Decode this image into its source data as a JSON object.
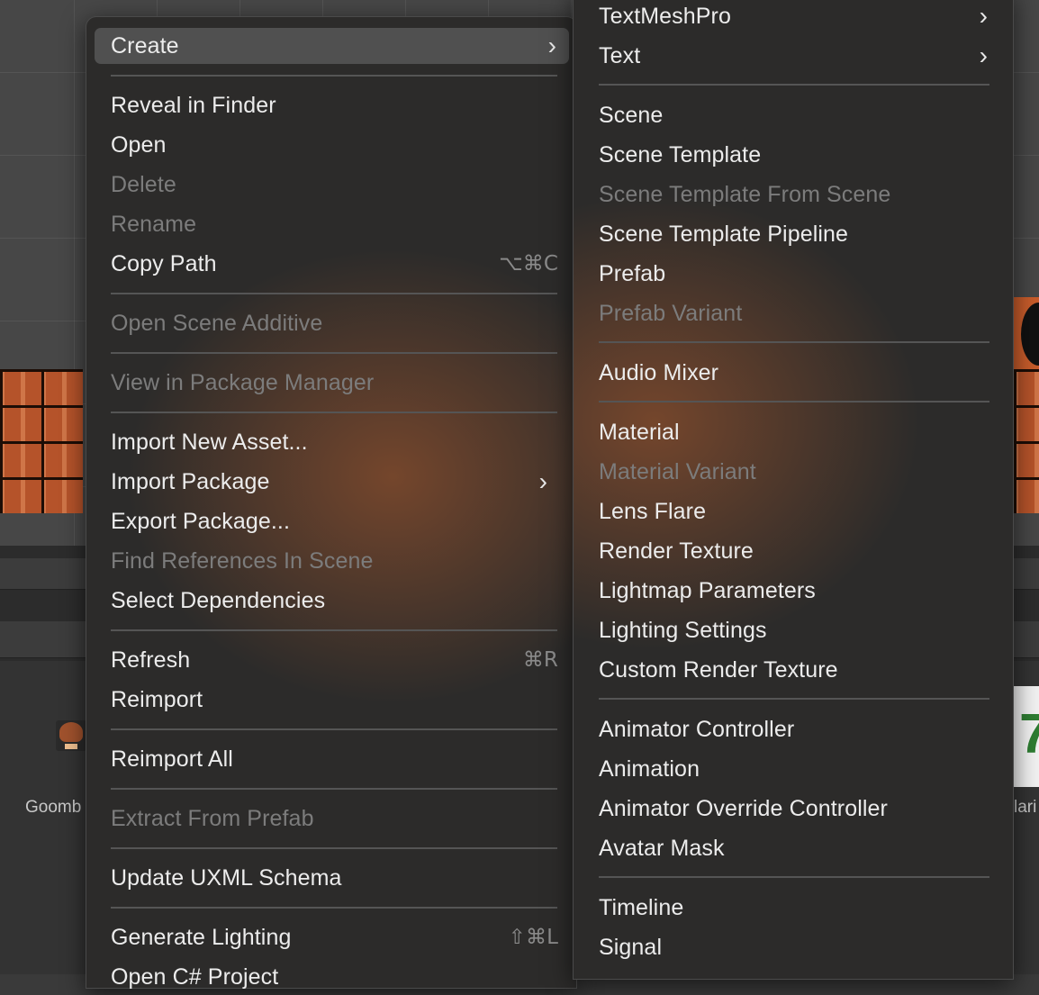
{
  "background": {
    "asset_labels": {
      "left": "Goomb",
      "right": "lari"
    },
    "asset_icon_right": "7"
  },
  "context_menu": {
    "items": [
      {
        "label": "Create",
        "submenu": true,
        "highlighted": true
      },
      {
        "label": "Reveal in Finder"
      },
      {
        "label": "Open"
      },
      {
        "label": "Delete",
        "disabled": true
      },
      {
        "label": "Rename",
        "disabled": true
      },
      {
        "label": "Copy Path",
        "shortcut": "⌥⌘C"
      },
      {
        "label": "Open Scene Additive",
        "disabled": true
      },
      {
        "label": "View in Package Manager",
        "disabled": true
      },
      {
        "label": "Import New Asset..."
      },
      {
        "label": "Import Package",
        "submenu": true
      },
      {
        "label": "Export Package..."
      },
      {
        "label": "Find References In Scene",
        "disabled": true
      },
      {
        "label": "Select Dependencies"
      },
      {
        "label": "Refresh",
        "shortcut": "⌘R"
      },
      {
        "label": "Reimport"
      },
      {
        "label": "Reimport All"
      },
      {
        "label": "Extract From Prefab",
        "disabled": true
      },
      {
        "label": "Update UXML Schema"
      },
      {
        "label": "Generate Lighting",
        "shortcut": "⇧⌘L"
      },
      {
        "label": "Open C# Project"
      }
    ]
  },
  "create_submenu": {
    "items": [
      {
        "label": "TextMeshPro",
        "submenu": true
      },
      {
        "label": "Text",
        "submenu": true
      },
      {
        "label": "Scene"
      },
      {
        "label": "Scene Template"
      },
      {
        "label": "Scene Template From Scene",
        "disabled": true
      },
      {
        "label": "Scene Template Pipeline"
      },
      {
        "label": "Prefab"
      },
      {
        "label": "Prefab Variant",
        "disabled": true
      },
      {
        "label": "Audio Mixer"
      },
      {
        "label": "Material"
      },
      {
        "label": "Material Variant",
        "disabled": true
      },
      {
        "label": "Lens Flare"
      },
      {
        "label": "Render Texture"
      },
      {
        "label": "Lightmap Parameters"
      },
      {
        "label": "Lighting Settings"
      },
      {
        "label": "Custom Render Texture"
      },
      {
        "label": "Animator Controller"
      },
      {
        "label": "Animation"
      },
      {
        "label": "Animator Override Controller"
      },
      {
        "label": "Avatar Mask"
      },
      {
        "label": "Timeline"
      },
      {
        "label": "Signal"
      }
    ]
  },
  "icons": {
    "submenu_arrow": "chevron-right-icon"
  },
  "colors": {
    "menu_bg": "#2c2b2a",
    "highlight_bg": "#505050",
    "text": "#ececec",
    "disabled_text": "#7c7c7c",
    "shortcut_text": "#8a8a8a"
  }
}
